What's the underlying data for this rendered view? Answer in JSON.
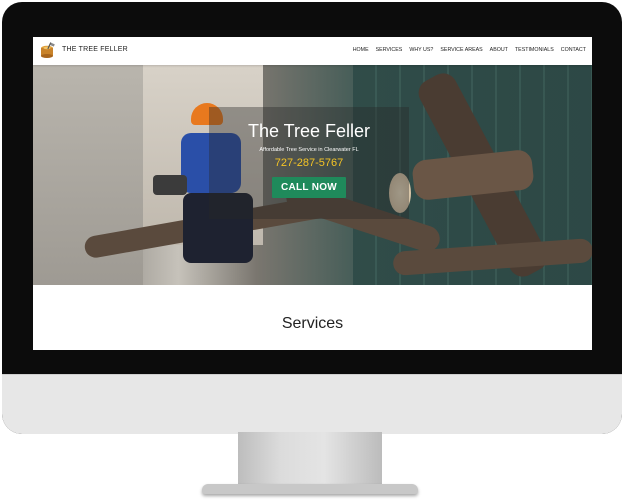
{
  "header": {
    "brand": "THE TREE FELLER",
    "logo_icon": "tree-stump-axe-icon",
    "nav": [
      "HOME",
      "SERVICES",
      "WHY US?",
      "SERVICE AREAS",
      "ABOUT",
      "TESTIMONIALS",
      "CONTACT"
    ]
  },
  "hero": {
    "title": "The Tree Feller",
    "subtitle": "Affordable Tree Service in Clearwater FL",
    "phone": "727-287-5767",
    "cta_label": "CALL NOW"
  },
  "sections": {
    "services_title": "Services"
  },
  "colors": {
    "accent_green": "#1f8a5b",
    "phone_yellow": "#f5c425",
    "monitor_bezel": "#0c0c0c"
  }
}
